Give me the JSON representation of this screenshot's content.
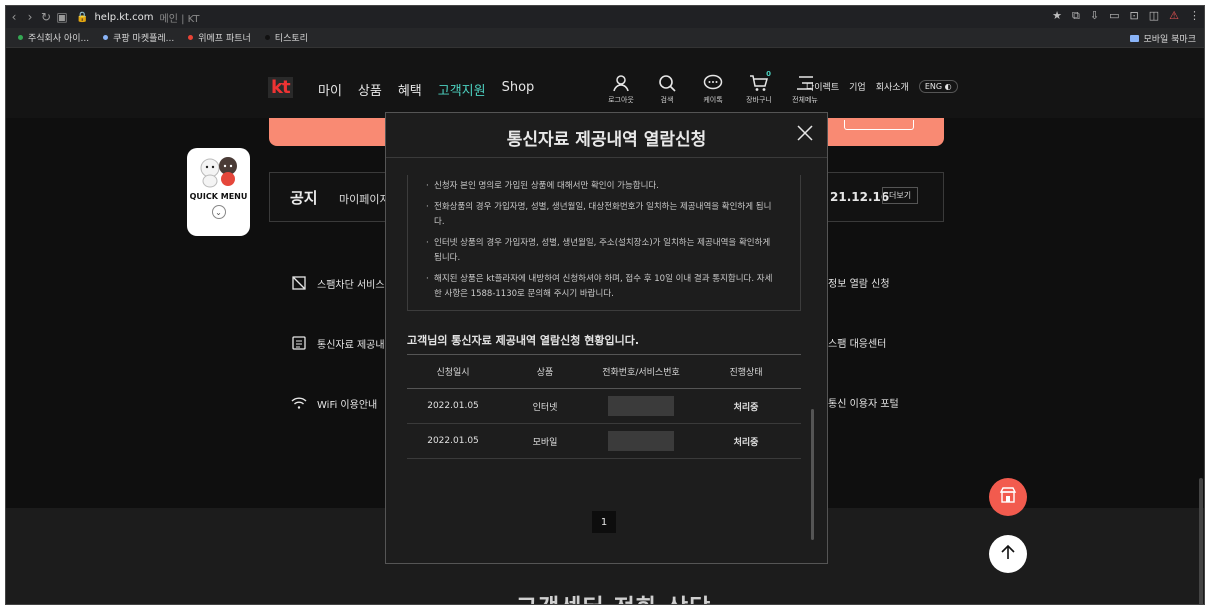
{
  "browser": {
    "url": "help.kt.com",
    "title_suffix": "메인 | KT",
    "bookmarks": [
      {
        "label": "주식회사 아이...",
        "color": "#34a853"
      },
      {
        "label": "쿠팡 마켓플레...",
        "color": "#8ab4f8"
      },
      {
        "label": "위메프 파트너",
        "color": "#ea4335"
      },
      {
        "label": "티스토리",
        "color": "#111111"
      }
    ],
    "bookmark_folder": "모바일 북마크"
  },
  "header": {
    "logo": "kt",
    "nav": [
      {
        "label": "마이",
        "active": false
      },
      {
        "label": "상품",
        "active": false
      },
      {
        "label": "혜택",
        "active": false
      },
      {
        "label": "고객지원",
        "active": true
      },
      {
        "label": "Shop",
        "active": false
      }
    ],
    "utilities": [
      {
        "icon": "user-icon",
        "label": "로그아웃"
      },
      {
        "icon": "search-icon",
        "label": "검색"
      },
      {
        "icon": "chat-icon",
        "label": "케이톡"
      },
      {
        "icon": "cart-icon",
        "label": "장바구니",
        "badge": "0"
      },
      {
        "icon": "menu-icon",
        "label": "전체메뉴"
      }
    ],
    "links": [
      "다이렉트",
      "기업",
      "회사소개"
    ],
    "lang": "ENG"
  },
  "page": {
    "quick_menu": "QUICK MENU",
    "notice": {
      "title": "공지",
      "text": "마이페이지",
      "date": "21.12.16",
      "more": "더보기"
    },
    "services_left": [
      "스팸차단 서비스",
      "통신자료 제공내",
      "WiFi 이용안내"
    ],
    "services_right": [
      "정보 열람 신청",
      "스팸 대응센터",
      "통신 이용자 포털"
    ],
    "bottom_title": "고객센터 전화 상담"
  },
  "modal": {
    "title": "통신자료 제공내역 열람신청",
    "notes": [
      "신청자 본인 명의로 가입된 상품에 대해서만 확인이 가능합니다.",
      "전화상품의 경우 가입자명, 성별, 생년월일, 대상전화번호가 일치하는 제공내역을 확인하게 됩니다.",
      "인터넷 상품의 경우 가입자명, 성별, 생년월일, 주소(설치장소)가 일치하는 제공내역을 확인하게 됩니다.",
      "해지된 상품은 kt플라자에 내방하여 신청하셔야 하며, 접수 후 10일 이내 결과 통지합니다. 자세한 사항은 1588-1130로 문의해 주시기 바랍니다."
    ],
    "status_heading": "고객님의 통신자료 제공내역 열람신청 현황입니다.",
    "table": {
      "headers": [
        "신청일시",
        "상품",
        "전화번호/서비스번호",
        "진행상태"
      ],
      "rows": [
        {
          "date": "2022.01.05",
          "product": "인터넷",
          "status": "처리중"
        },
        {
          "date": "2022.01.05",
          "product": "모바일",
          "status": "처리중"
        }
      ]
    },
    "page_number": "1"
  }
}
